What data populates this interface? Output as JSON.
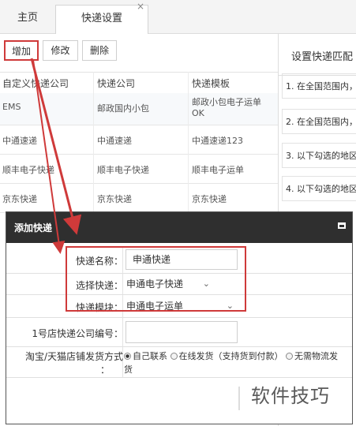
{
  "tabs": [
    {
      "label": "主页"
    },
    {
      "label": "快递设置",
      "close": "×"
    }
  ],
  "toolbar": {
    "add_label": "增加",
    "edit_label": "修改",
    "delete_label": "删除"
  },
  "grid": {
    "columns": [
      "自定义快递公司",
      "快递公司",
      "快递模板"
    ],
    "rows": [
      [
        "EMS",
        "邮政国内小包",
        "邮政小包电子运单",
        "OK"
      ],
      [
        "中通速递",
        "中通速递",
        "中通速递123",
        ""
      ],
      [
        "顺丰电子快递",
        "顺丰电子快递",
        "顺丰电子运单",
        ""
      ],
      [
        "京东快递",
        "京东快递",
        "京东快递",
        ""
      ]
    ]
  },
  "right_panel": {
    "title": "设置快递匹配",
    "items": [
      "1. 在全国范围内，",
      "2. 在全国范围内，",
      "3. 以下勾选的地区",
      "4. 以下勾选的地区"
    ]
  },
  "modal": {
    "title": "添加快递",
    "fields": {
      "name_label": "快递名称：",
      "name_value": "申通快递",
      "select_label": "选择快递：",
      "select_value": "申通电子快递",
      "template_label": "快递模块：",
      "template_value": "申通电子运单",
      "store_code_label": "1号店快递公司编号：",
      "store_code_value": "",
      "ship_method_label_1": "淘宝/天猫店铺发货方式",
      "ship_method_label_2": "：",
      "ship_options": [
        "自己联系",
        "在线发货（支持货到付款）",
        "无需物流发"
      ],
      "ship_option_wrap": "货"
    }
  },
  "watermark": "软件技巧",
  "colors": {
    "highlight": "#cf3a3a",
    "modal_header": "#2f2f2f"
  }
}
